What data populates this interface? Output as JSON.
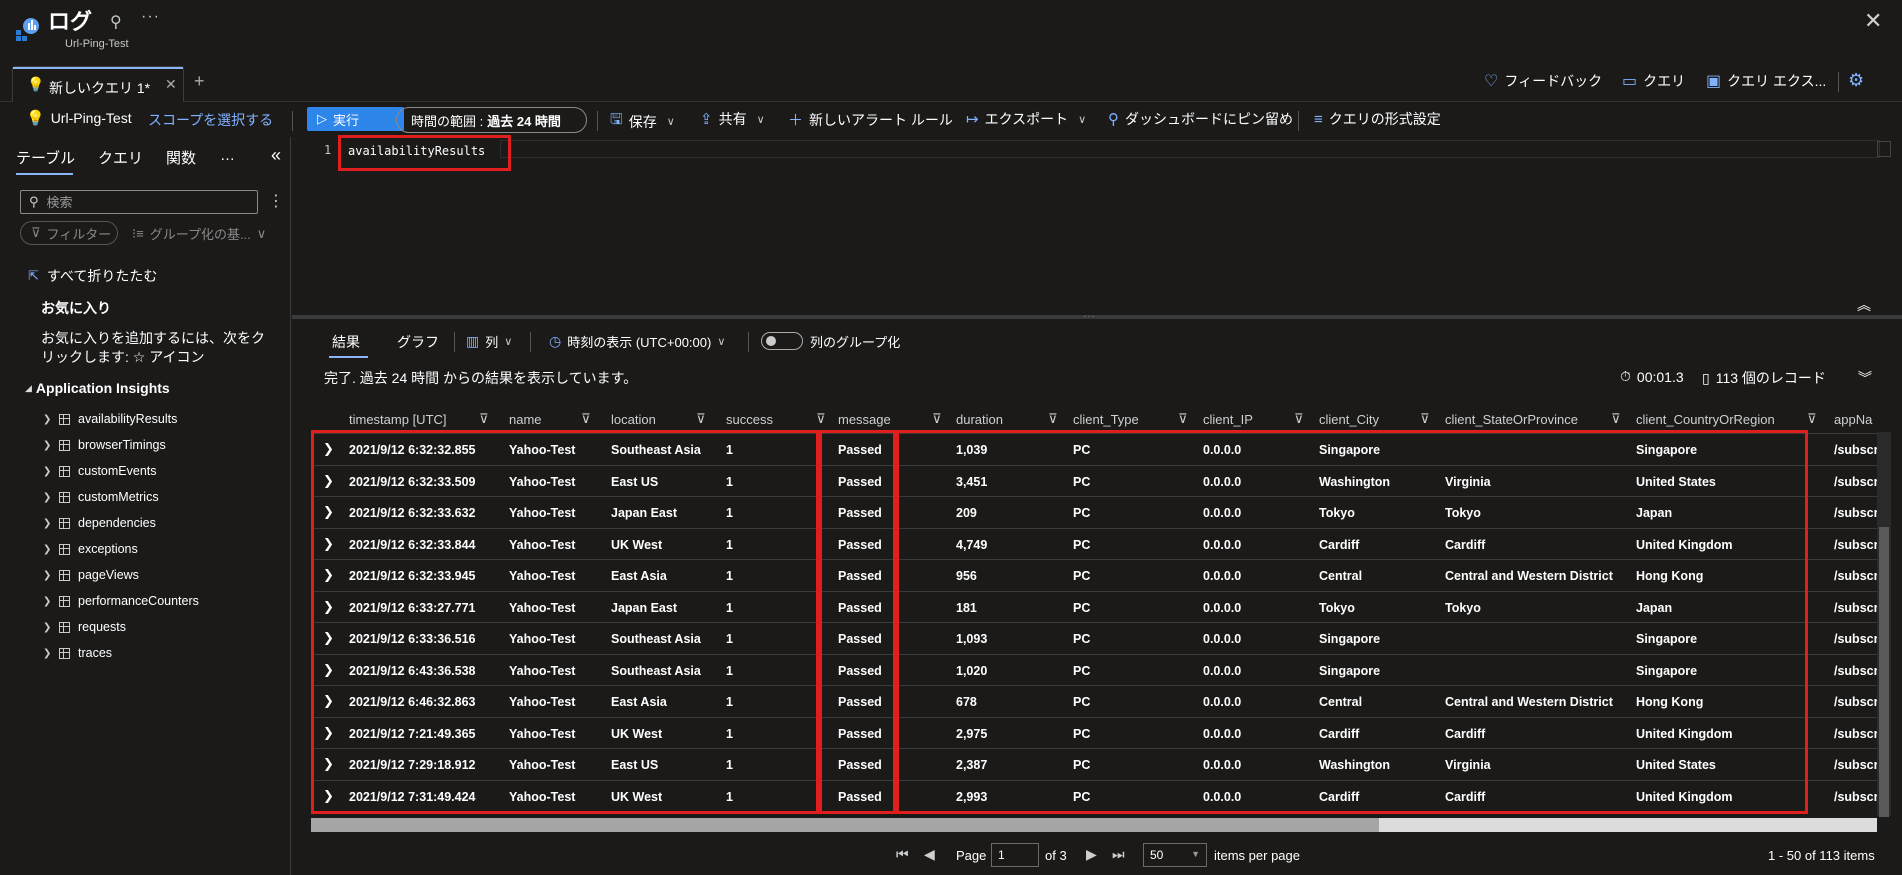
{
  "header": {
    "title": "ログ",
    "subtitle": "Url-Ping-Test",
    "pin_icon": "pin-icon",
    "more_icon": "more-icon",
    "close_icon": "close-icon"
  },
  "tabs": {
    "query_tab": "新しいクエリ 1*",
    "new_tab_icon": "plus-icon",
    "right_links": [
      {
        "label": "フィードバック",
        "icon": "heart-icon"
      },
      {
        "label": "クエリ",
        "icon": "query-icon"
      },
      {
        "label": "クエリ エクス...",
        "icon": "query-explorer-icon"
      }
    ]
  },
  "command_bar": {
    "scope_name": "Url-Ping-Test",
    "scope_link": "スコープを選択する",
    "run": "実行",
    "time_range_label": "時間の範囲 :",
    "time_range_value": "過去 24 時間",
    "save": "保存",
    "share": "共有",
    "new_alert": "新しいアラート ルール",
    "export": "エクスポート",
    "pin_dashboard": "ダッシュボードにピン留め",
    "format_query": "クエリの形式設定"
  },
  "left_panel": {
    "tabs": [
      "テーブル",
      "クエリ",
      "関数"
    ],
    "more": "…",
    "search_placeholder": "検索",
    "filter": "フィルター",
    "group_by": "グループ化の基...",
    "collapse_all": "すべて折りたたむ",
    "favorites_heading": "お気に入り",
    "favorites_desc": "お気に入りを追加するには、次をクリックします: ☆ アイコン",
    "section_heading": "Application Insights",
    "tables": [
      "availabilityResults",
      "browserTimings",
      "customEvents",
      "customMetrics",
      "dependencies",
      "exceptions",
      "pageViews",
      "performanceCounters",
      "requests",
      "traces"
    ]
  },
  "editor": {
    "line_number": "1",
    "code": "availabilityResults"
  },
  "results_toolbar": {
    "results_tab": "結果",
    "chart_tab": "グラフ",
    "columns": "列",
    "time_display": "時刻の表示 (UTC+00:00)",
    "group_columns": "列のグループ化"
  },
  "status": {
    "message": "完了. 過去 24 時間 からの結果を表示しています。",
    "elapsed": "00:01.3",
    "records": "113 個のレコード"
  },
  "grid": {
    "columns": [
      "timestamp [UTC]",
      "name",
      "location",
      "success",
      "message",
      "duration",
      "client_Type",
      "client_IP",
      "client_City",
      "client_StateOrProvince",
      "client_CountryOrRegion",
      "appNa"
    ],
    "rows": [
      [
        "2021/9/12 6:32:32.855",
        "Yahoo-Test",
        "Southeast Asia",
        "1",
        "Passed",
        "1,039",
        "PC",
        "0.0.0.0",
        "Singapore",
        "",
        "Singapore",
        "/subscr"
      ],
      [
        "2021/9/12 6:32:33.509",
        "Yahoo-Test",
        "East US",
        "1",
        "Passed",
        "3,451",
        "PC",
        "0.0.0.0",
        "Washington",
        "Virginia",
        "United States",
        "/subscr"
      ],
      [
        "2021/9/12 6:32:33.632",
        "Yahoo-Test",
        "Japan East",
        "1",
        "Passed",
        "209",
        "PC",
        "0.0.0.0",
        "Tokyo",
        "Tokyo",
        "Japan",
        "/subscr"
      ],
      [
        "2021/9/12 6:32:33.844",
        "Yahoo-Test",
        "UK West",
        "1",
        "Passed",
        "4,749",
        "PC",
        "0.0.0.0",
        "Cardiff",
        "Cardiff",
        "United Kingdom",
        "/subscr"
      ],
      [
        "2021/9/12 6:32:33.945",
        "Yahoo-Test",
        "East Asia",
        "1",
        "Passed",
        "956",
        "PC",
        "0.0.0.0",
        "Central",
        "Central and Western District",
        "Hong Kong",
        "/subscr"
      ],
      [
        "2021/9/12 6:33:27.771",
        "Yahoo-Test",
        "Japan East",
        "1",
        "Passed",
        "181",
        "PC",
        "0.0.0.0",
        "Tokyo",
        "Tokyo",
        "Japan",
        "/subscr"
      ],
      [
        "2021/9/12 6:33:36.516",
        "Yahoo-Test",
        "Southeast Asia",
        "1",
        "Passed",
        "1,093",
        "PC",
        "0.0.0.0",
        "Singapore",
        "",
        "Singapore",
        "/subscr"
      ],
      [
        "2021/9/12 6:43:36.538",
        "Yahoo-Test",
        "Southeast Asia",
        "1",
        "Passed",
        "1,020",
        "PC",
        "0.0.0.0",
        "Singapore",
        "",
        "Singapore",
        "/subscr"
      ],
      [
        "2021/9/12 6:46:32.863",
        "Yahoo-Test",
        "East Asia",
        "1",
        "Passed",
        "678",
        "PC",
        "0.0.0.0",
        "Central",
        "Central and Western District",
        "Hong Kong",
        "/subscr"
      ],
      [
        "2021/9/12 7:21:49.365",
        "Yahoo-Test",
        "UK West",
        "1",
        "Passed",
        "2,975",
        "PC",
        "0.0.0.0",
        "Cardiff",
        "Cardiff",
        "United Kingdom",
        "/subscr"
      ],
      [
        "2021/9/12 7:29:18.912",
        "Yahoo-Test",
        "East US",
        "1",
        "Passed",
        "2,387",
        "PC",
        "0.0.0.0",
        "Washington",
        "Virginia",
        "United States",
        "/subscr"
      ],
      [
        "2021/9/12 7:31:49.424",
        "Yahoo-Test",
        "UK West",
        "1",
        "Passed",
        "2,993",
        "PC",
        "0.0.0.0",
        "Cardiff",
        "Cardiff",
        "United Kingdom",
        "/subscr"
      ]
    ]
  },
  "pagination": {
    "page_label": "Page",
    "page_value": "1",
    "of_label": "of 3",
    "per_page_value": "50",
    "per_page_label": "items per page",
    "range": "1 - 50 of 113 items"
  },
  "colors": {
    "accent": "#2f86ea",
    "highlight_box": "#e01e1e",
    "background": "#1b1a19"
  }
}
